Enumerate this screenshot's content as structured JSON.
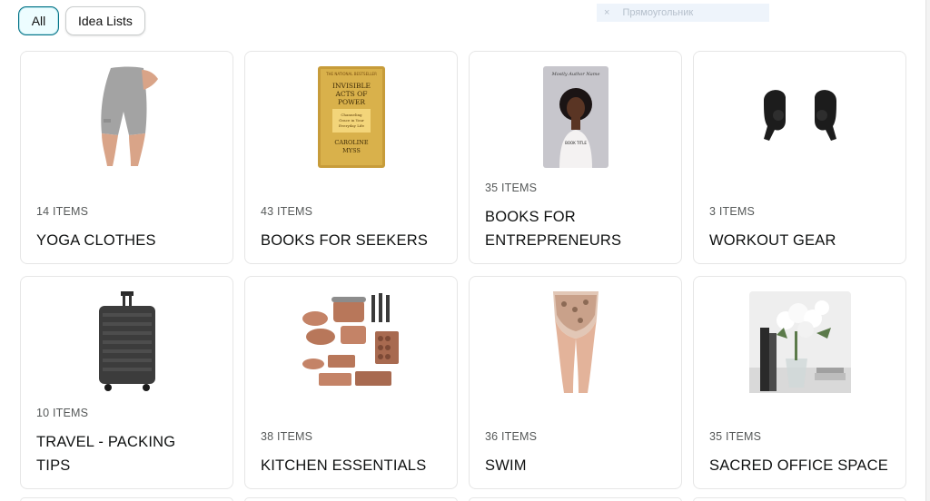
{
  "tabs": [
    {
      "label": "All",
      "active": true
    },
    {
      "label": "Idea Lists",
      "active": false
    }
  ],
  "overlay": {
    "text": "Прямоугольник"
  },
  "lists": [
    {
      "count": "14 ITEMS",
      "title": "YOGA CLOTHES",
      "icon": "yoga-shorts-image"
    },
    {
      "count": "43 ITEMS",
      "title": "BOOKS FOR SEEKERS",
      "icon": "book-cover-image",
      "book": {
        "top": "THE NATIONAL BESTSELLER",
        "title": "INVISIBLE ACTS OF POWER",
        "subtitle": "Channeling Grace in Your Everyday Life",
        "author": "CAROLINE MYSS"
      }
    },
    {
      "count": "35 ITEMS",
      "title": "BOOKS FOR ENTREPRENEURS",
      "icon": "book-portrait-image"
    },
    {
      "count": "3 ITEMS",
      "title": "WORKOUT GEAR",
      "icon": "earbuds-image"
    },
    {
      "count": "10 ITEMS",
      "title": "TRAVEL - PACKING TIPS",
      "icon": "suitcase-image"
    },
    {
      "count": "38 ITEMS",
      "title": "KITCHEN ESSENTIALS",
      "icon": "cookware-image"
    },
    {
      "count": "36 ITEMS",
      "title": "SWIM",
      "icon": "swim-bottom-image"
    },
    {
      "count": "35 ITEMS",
      "title": "SACRED OFFICE SPACE",
      "icon": "office-decor-image"
    }
  ]
}
